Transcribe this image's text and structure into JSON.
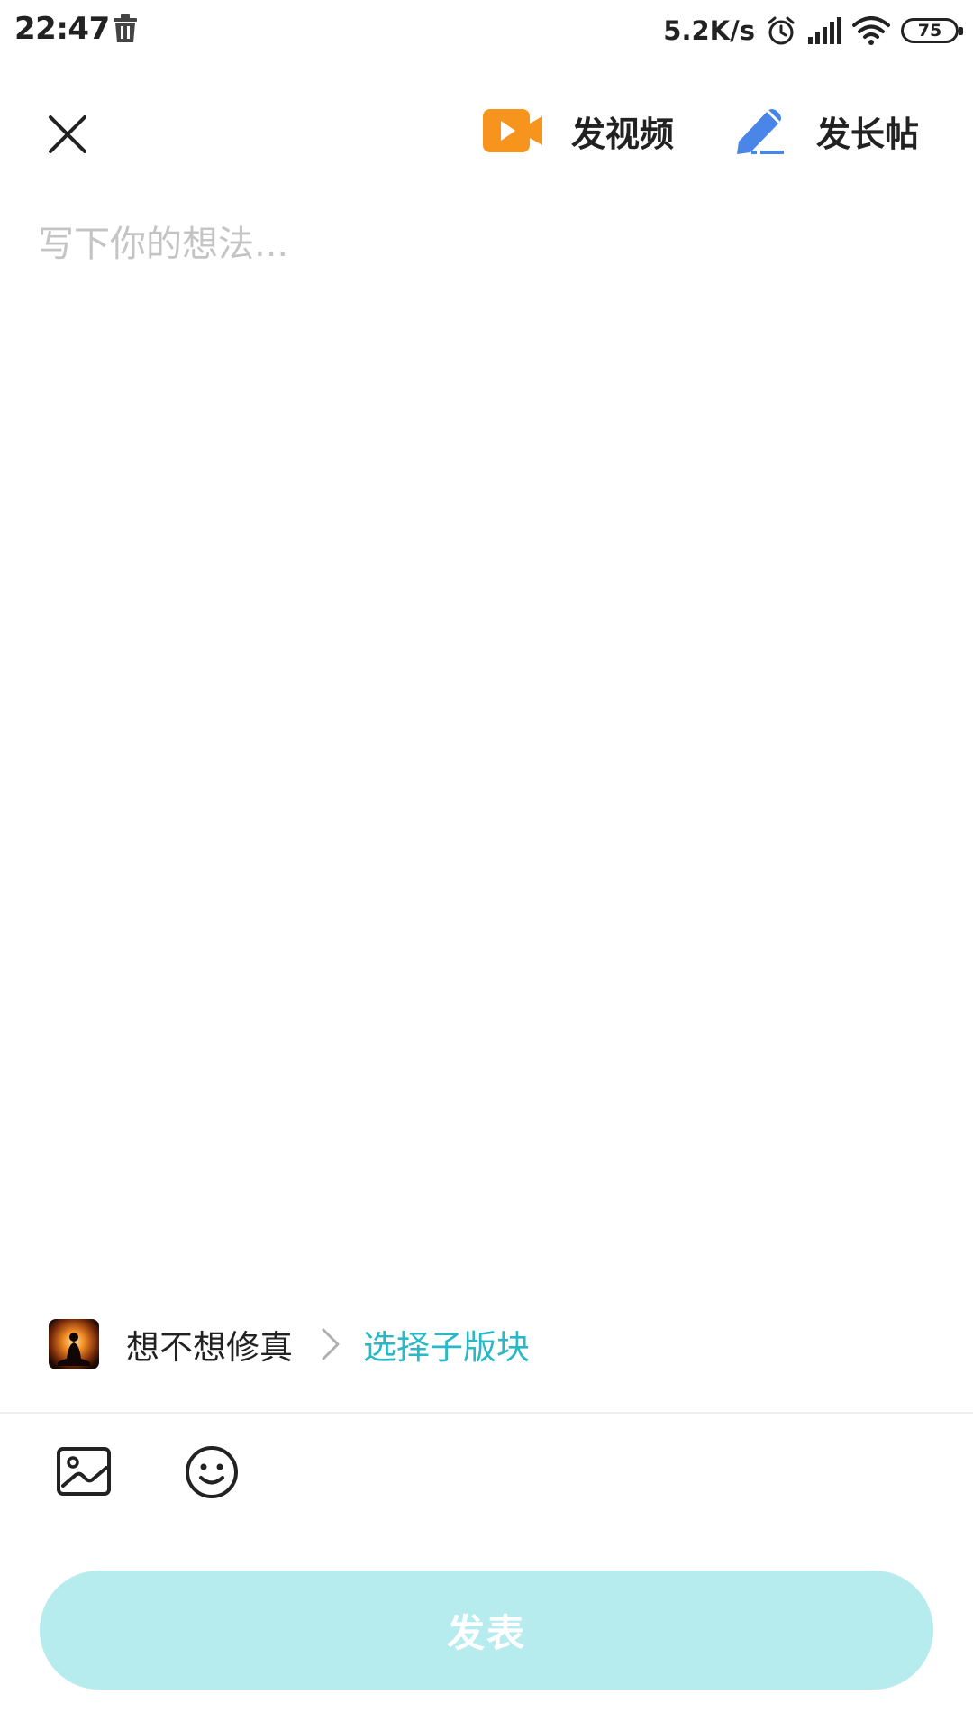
{
  "status_bar": {
    "time": "22:47",
    "network_speed": "5.2K/s",
    "battery_level": "75",
    "icons": [
      "trash-icon",
      "alarm-icon",
      "signal-icon",
      "wifi-icon",
      "battery-icon"
    ]
  },
  "toolbar": {
    "close_icon": "close-icon",
    "video_label": "发视频",
    "video_icon": "video-camera-icon",
    "long_post_label": "发长帖",
    "long_post_icon": "pen-icon"
  },
  "editor": {
    "placeholder": "写下你的想法...",
    "value": ""
  },
  "forum": {
    "name": "想不想修真",
    "subforum_link": "选择子版块"
  },
  "attachments": {
    "image_icon": "image-icon",
    "emoji_icon": "emoji-icon"
  },
  "publish_button": {
    "label": "发表",
    "state": "disabled"
  },
  "colors": {
    "accent": "#2ab8c6",
    "publish_bg": "#b7ecef",
    "video_icon": "#f7941d",
    "pen_icon": "#4a86e8",
    "placeholder": "#c4c4c4",
    "divider": "#eeeeee"
  }
}
